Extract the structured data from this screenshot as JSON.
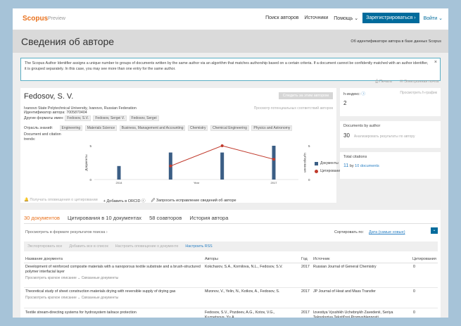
{
  "header": {
    "logo": "Scopus",
    "logo_sub": "Preview",
    "nav": [
      "Поиск авторов",
      "Источники",
      "Помощь ⌄"
    ],
    "register": "Зарегистрироваться ›",
    "login": "Войти ⌄"
  },
  "page": {
    "title": "Сведения об авторе",
    "id_hint": "Об идентификаторе автора в базе данных Scopus"
  },
  "notice": {
    "text": "The Scopus Author Identifier assigns a unique number to groups of documents written by the same author via an algorithm that matches authorship based on a certain criteria. If a document cannot be confidently matched with an author identifier, it is grouped separately. In this case, you may see more than one entry for the same author.",
    "close": "×"
  },
  "util": {
    "print": "Печать",
    "email": "Электронная почта"
  },
  "author": {
    "name": "Fedosov, S. V.",
    "follow": "Следить за этим автором",
    "affiliation": "Ivanovo State Polytechnical University, Ivanovo, Russian Federation",
    "id_label": "Идентификатор автора:",
    "id_value": "7005870404",
    "other_label": "Другие форматы имен:",
    "other_names": [
      "Fedosov, S.V.",
      "Fedosov, Sergei V.",
      "Fedosov, Sergei"
    ],
    "potential": "Просмотр потенциальных соответствий авторов",
    "subject_label": "Отрасль знаний:",
    "subjects": [
      "Engineering",
      "Materials Science",
      "Business, Management and Accounting",
      "Chemistry",
      "Chemical Engineering",
      "Physics and Astronomy"
    ],
    "trends_label": "Document and citation trends:"
  },
  "actions": {
    "alert": "Получать оповещения о цитировании",
    "orcid": "+ Добавить в ORCID ⓘ",
    "correction": "Запросить исправление сведений об авторе"
  },
  "metrics": {
    "h_label": "h-индекс:",
    "h_value": "2",
    "h_link": "Просмотреть h-график",
    "docs_label": "Documents by author",
    "docs_value": "30",
    "docs_link": "Анализировать результаты по автору",
    "cit_label": "Total citations",
    "cit_value": "11",
    "cit_by": "by",
    "cit_docs": "10",
    "cit_docs_word": "documents"
  },
  "tabs": [
    "30 документов",
    "Цитирования в 10 документах",
    "58 соавторов",
    "История автора"
  ],
  "results": {
    "view_format": "Просмотреть в формате результатов поиска ›",
    "sort_label": "Сортировать по:",
    "sort_value": "Дата (самые новые)",
    "toolbar": [
      "Экспортировать все",
      "Добавить все в список",
      "Настроить оповещение о документе",
      "Настроить RSS"
    ],
    "columns": [
      "Название документа",
      "Авторы",
      "Год",
      "Источник",
      "Цитирования"
    ],
    "rows": [
      {
        "title": "Development of reinforced composite materials with a nanoporous textile substrate and a brush-structured polymer interfacial layer",
        "authors": "Kokcharov, S.A., Kornilova, N.L., Fedosov, S.V.",
        "year": "2017",
        "source": "Russian Journal of General Chemistry",
        "cited": "0",
        "sub": "Просмотреть краткое описание ⌄     Связанные документы"
      },
      {
        "title": "Theoretical study of sheet construction materials drying with reversible supply of drying gas",
        "authors": "Mizonov, V., Yelin, N., Kotkov, A., Fedosov, S.",
        "year": "2017",
        "source": "JP Journal of Heat and Mass Transfer",
        "cited": "0",
        "sub": "Просмотреть краткое описание ⌄     Связанные документы"
      },
      {
        "title": "Textile stream-directing systems for hydrosystem tailrace protection",
        "authors": "Fedosov, S.V., Pozdeev, A.G., Kotov, V.G., Kuznetsova, Yu.A.",
        "year": "2017",
        "source": "Izvestiya Vysshikh Uchebnykh Zavedenii, Seriya Teknologiya Tekstil'noi Promyshlennosti",
        "cited": "0",
        "sub": ""
      }
    ]
  },
  "chart_data": {
    "type": "bar",
    "categories": [
      "2014",
      "2015",
      "2016",
      "2017"
    ],
    "series": [
      {
        "name": "Документы",
        "values": [
          2,
          4,
          4,
          5
        ]
      },
      {
        "name": "Цитирования",
        "values": [
          null,
          2,
          5,
          3
        ]
      }
    ],
    "ylabel_left": "Документы",
    "ylabel_right": "Цитирования",
    "xlabel": "Year",
    "y_ticks": [
      0,
      5
    ],
    "ylim": [
      0,
      5
    ],
    "x_tick_labels": [
      "2014",
      "2017"
    ],
    "legend": "right",
    "colors": {
      "bars": "#3b5e85",
      "line": "#c0392b"
    }
  },
  "colors": {
    "brand": "#e9711c",
    "primary": "#006b9c",
    "link": "#2a80c4"
  }
}
